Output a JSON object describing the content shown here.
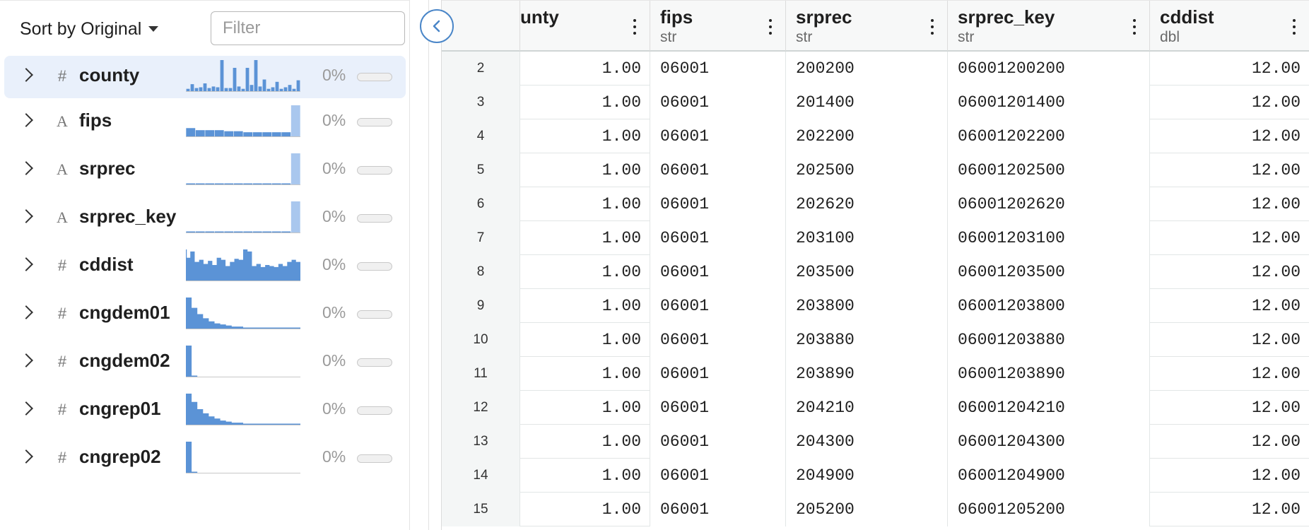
{
  "toolbar": {
    "sort_label": "Sort by Original",
    "filter_placeholder": "Filter"
  },
  "summary": [
    {
      "name": "county",
      "type": "#",
      "pct": "0%",
      "hist": [
        3,
        9,
        4,
        5,
        10,
        4,
        6,
        5,
        40,
        4,
        4,
        30,
        6,
        3,
        30,
        8,
        40,
        6,
        15,
        3,
        5,
        12,
        3,
        5,
        8,
        3,
        14
      ],
      "kind": "bars"
    },
    {
      "name": "fips",
      "type": "A",
      "pct": "0%",
      "hist": [
        8,
        6,
        6,
        6,
        5,
        5,
        4,
        4,
        4,
        4,
        4,
        30
      ],
      "kind": "steps"
    },
    {
      "name": "srprec",
      "type": "A",
      "pct": "0%",
      "hist": [
        1,
        1,
        1,
        1,
        1,
        1,
        1,
        1,
        1,
        1,
        1,
        30
      ],
      "kind": "steps"
    },
    {
      "name": "srprec_key",
      "type": "A",
      "pct": "0%",
      "hist": [
        1,
        1,
        1,
        1,
        1,
        1,
        1,
        1,
        1,
        1,
        1,
        30
      ],
      "kind": "steps"
    },
    {
      "name": "cddist",
      "type": "#",
      "pct": "0%",
      "hist": [
        22,
        28,
        18,
        20,
        16,
        19,
        15,
        22,
        20,
        14,
        18,
        21,
        20,
        30,
        28,
        14,
        16,
        13,
        15,
        14,
        13,
        16,
        14,
        18,
        20,
        18
      ],
      "kind": "area"
    },
    {
      "name": "cngdem01",
      "type": "#",
      "pct": "0%",
      "hist": [
        30,
        20,
        14,
        10,
        7,
        5,
        4,
        3,
        2,
        2,
        1,
        1,
        1,
        1,
        1,
        1,
        1,
        1,
        1,
        1
      ],
      "kind": "area"
    },
    {
      "name": "cngdem02",
      "type": "#",
      "pct": "0%",
      "hist": [
        30,
        1,
        0,
        0,
        0,
        0,
        0,
        0,
        0,
        0,
        0,
        0,
        0,
        0,
        0,
        0,
        0,
        0,
        0,
        0
      ],
      "kind": "area"
    },
    {
      "name": "cngrep01",
      "type": "#",
      "pct": "0%",
      "hist": [
        30,
        22,
        15,
        11,
        8,
        6,
        4,
        3,
        2,
        2,
        1,
        1,
        1,
        1,
        1,
        1,
        1,
        1,
        1,
        1
      ],
      "kind": "area"
    },
    {
      "name": "cngrep02",
      "type": "#",
      "pct": "0%",
      "hist": [
        30,
        1,
        0,
        0,
        0,
        0,
        0,
        0,
        0,
        0,
        0,
        0,
        0,
        0,
        0,
        0,
        0,
        0,
        0,
        0
      ],
      "kind": "area"
    }
  ],
  "colors": {
    "accent": "#4a86c8",
    "spark": "#5b93d6",
    "spark_light": "#a9c7ee",
    "selected_row": "#e9f0fb"
  },
  "grid": {
    "columns": [
      {
        "name": "",
        "type": ""
      },
      {
        "name": "unty",
        "type": ""
      },
      {
        "name": "fips",
        "type": "str"
      },
      {
        "name": "srprec",
        "type": "str"
      },
      {
        "name": "srprec_key",
        "type": "str"
      },
      {
        "name": "cddist",
        "type": "dbl"
      }
    ],
    "rows": [
      [
        "2",
        "1.00",
        "06001",
        "200200",
        "06001200200",
        "12.00"
      ],
      [
        "3",
        "1.00",
        "06001",
        "201400",
        "06001201400",
        "12.00"
      ],
      [
        "4",
        "1.00",
        "06001",
        "202200",
        "06001202200",
        "12.00"
      ],
      [
        "5",
        "1.00",
        "06001",
        "202500",
        "06001202500",
        "12.00"
      ],
      [
        "6",
        "1.00",
        "06001",
        "202620",
        "06001202620",
        "12.00"
      ],
      [
        "7",
        "1.00",
        "06001",
        "203100",
        "06001203100",
        "12.00"
      ],
      [
        "8",
        "1.00",
        "06001",
        "203500",
        "06001203500",
        "12.00"
      ],
      [
        "9",
        "1.00",
        "06001",
        "203800",
        "06001203800",
        "12.00"
      ],
      [
        "10",
        "1.00",
        "06001",
        "203880",
        "06001203880",
        "12.00"
      ],
      [
        "11",
        "1.00",
        "06001",
        "203890",
        "06001203890",
        "12.00"
      ],
      [
        "12",
        "1.00",
        "06001",
        "204210",
        "06001204210",
        "12.00"
      ],
      [
        "13",
        "1.00",
        "06001",
        "204300",
        "06001204300",
        "12.00"
      ],
      [
        "14",
        "1.00",
        "06001",
        "204900",
        "06001204900",
        "12.00"
      ],
      [
        "15",
        "1.00",
        "06001",
        "205200",
        "06001205200",
        "12.00"
      ]
    ]
  }
}
